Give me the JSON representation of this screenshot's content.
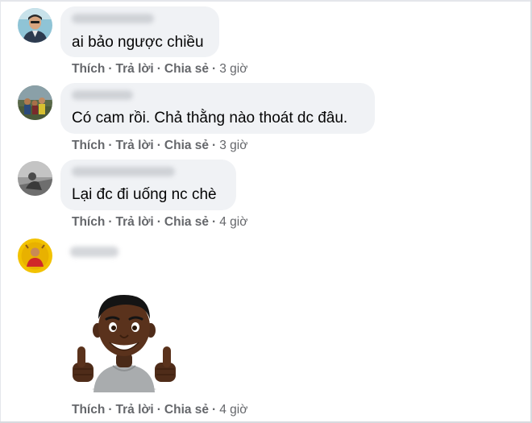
{
  "comments": [
    {
      "text": "ai bảo ngược chiều",
      "actions": {
        "like": "Thích",
        "reply": "Trả lời",
        "share": "Chia sẻ",
        "time": "3 giờ"
      }
    },
    {
      "text": "Có cam rồi. Chả thằng nào thoát dc đâu.",
      "actions": {
        "like": "Thích",
        "reply": "Trả lời",
        "share": "Chia sẻ",
        "time": "3 giờ"
      }
    },
    {
      "text": "Lại đc đi uống nc chè",
      "actions": {
        "like": "Thích",
        "reply": "Trả lời",
        "share": "Chia sẻ",
        "time": "4 giờ"
      }
    },
    {
      "sticker": "thumbs-up-avatar-sticker",
      "actions": {
        "like": "Thích",
        "reply": "Trả lời",
        "share": "Chia sẻ",
        "time": "4 giờ"
      }
    }
  ],
  "separator": "·",
  "colors": {
    "bubble": "#f0f2f5",
    "text": "#050505",
    "secondary": "#65676b"
  }
}
